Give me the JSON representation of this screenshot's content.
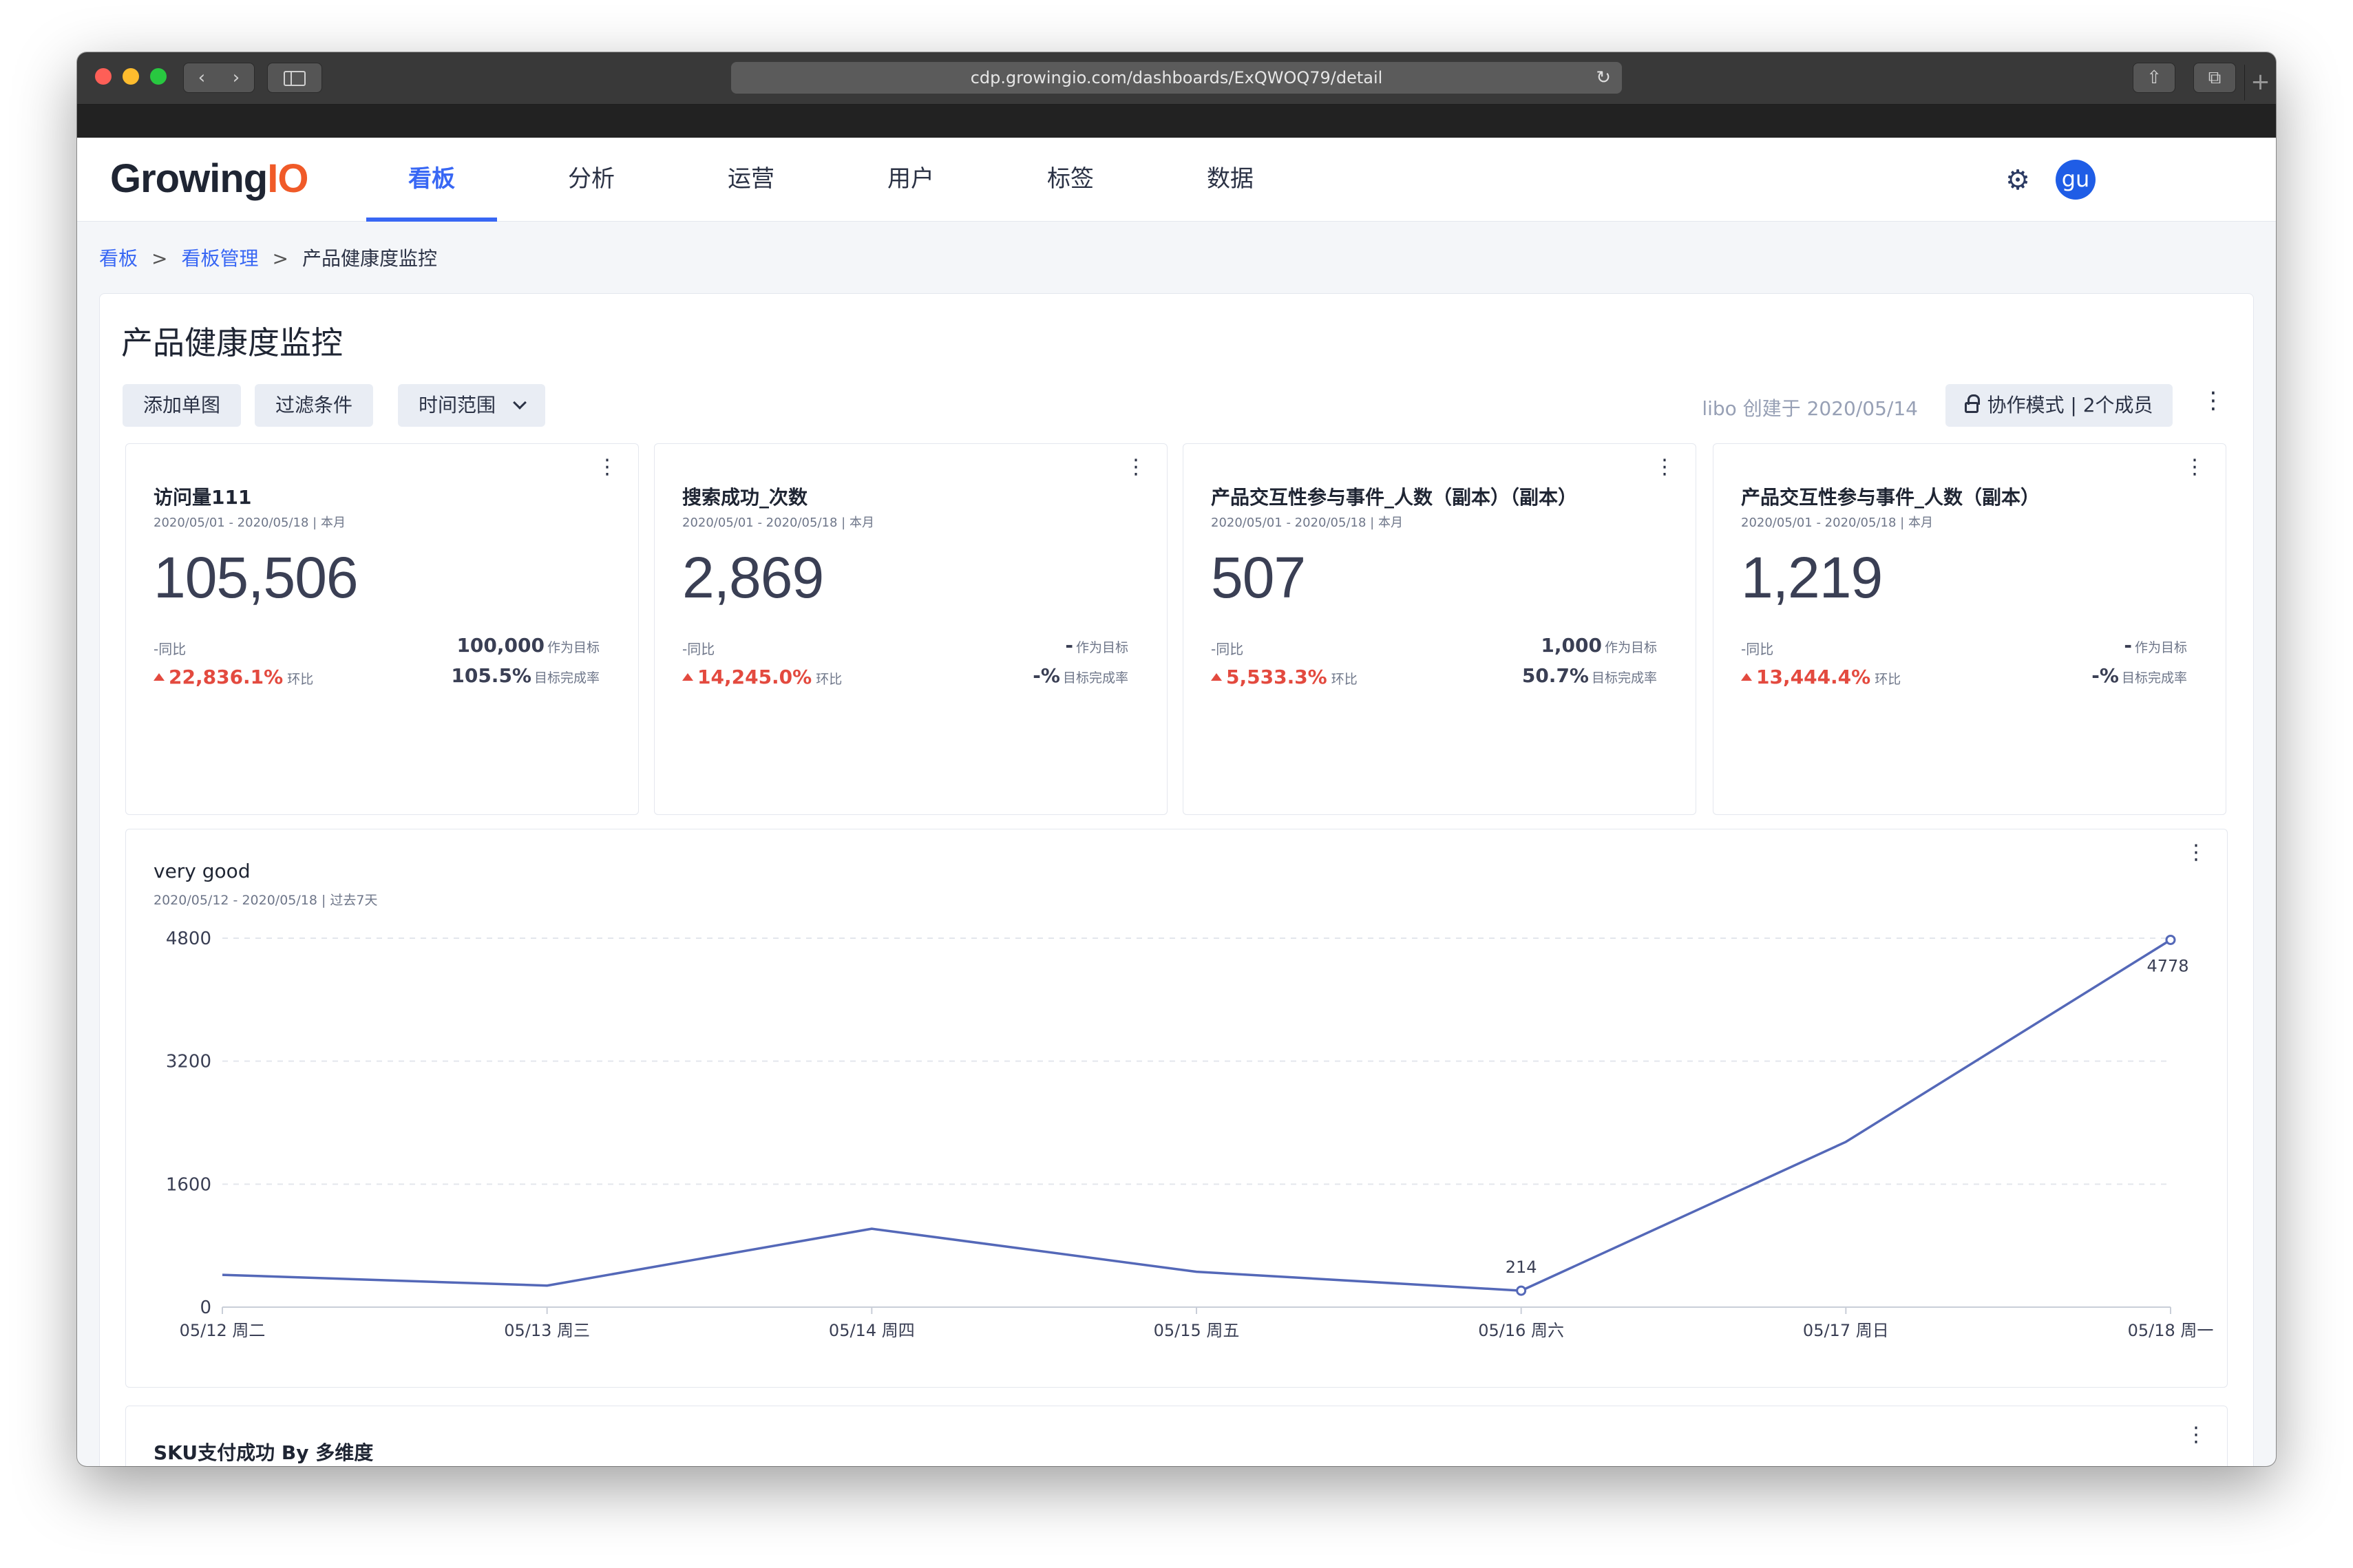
{
  "browser": {
    "url": "cdp.growingio.com/dashboards/ExQWOQ79/detail",
    "back_label": "‹",
    "forward_label": "›",
    "reload_glyph": "↻",
    "share_glyph": "⇧",
    "tabs_glyph": "⧉",
    "plus_glyph": "+"
  },
  "app": {
    "logo_main": "Growing",
    "logo_accent": "IO",
    "nav": [
      "看板",
      "分析",
      "运营",
      "用户",
      "标签",
      "数据"
    ],
    "active_nav": "看板",
    "avatar_text": "gu",
    "settings_icon": "gear-icon"
  },
  "breadcrumb": {
    "items": [
      "看板",
      "看板管理",
      "产品健康度监控"
    ],
    "separator": ">"
  },
  "page": {
    "title": "产品健康度监控",
    "toolbar": {
      "add_chart": "添加单图",
      "filter": "过滤条件",
      "time_range": "时间范围"
    },
    "creator_text": "libo 创建于 2020/05/14",
    "collab_text": "协作模式 | 2个成员",
    "more_glyph": "⋮"
  },
  "cards": [
    {
      "title": "访问量111",
      "subtitle": "2020/05/01 - 2020/05/18 | 本月",
      "value": "105,506",
      "yoy_value": "-",
      "yoy_label": "同比",
      "mom_value": "22,836.1%",
      "mom_label": "环比",
      "target_value": "100,000",
      "target_label": "作为目标",
      "completion_value": "105.5%",
      "completion_label": "目标完成率"
    },
    {
      "title": "搜索成功_次数",
      "subtitle": "2020/05/01 - 2020/05/18 | 本月",
      "value": "2,869",
      "yoy_value": "-",
      "yoy_label": "同比",
      "mom_value": "14,245.0%",
      "mom_label": "环比",
      "target_value": "-",
      "target_label": "作为目标",
      "completion_value": "-%",
      "completion_label": "目标完成率"
    },
    {
      "title": "产品交互性参与事件_人数（副本）（副本）",
      "subtitle": "2020/05/01 - 2020/05/18 | 本月",
      "value": "507",
      "yoy_value": "-",
      "yoy_label": "同比",
      "mom_value": "5,533.3%",
      "mom_label": "环比",
      "target_value": "1,000",
      "target_label": "作为目标",
      "completion_value": "50.7%",
      "completion_label": "目标完成率"
    },
    {
      "title": "产品交互性参与事件_人数（副本）",
      "subtitle": "2020/05/01 - 2020/05/18 | 本月",
      "value": "1,219",
      "yoy_value": "-",
      "yoy_label": "同比",
      "mom_value": "13,444.4%",
      "mom_label": "环比",
      "target_value": "-",
      "target_label": "作为目标",
      "completion_value": "-%",
      "completion_label": "目标完成率"
    }
  ],
  "line_card": {
    "title": "very good",
    "subtitle": "2020/05/12 - 2020/05/18 | 过去7天"
  },
  "bottom_card": {
    "title": "SKU支付成功 By 多维度"
  },
  "chart_data": {
    "type": "line",
    "x": [
      "05/12 周二",
      "05/13 周三",
      "05/14 周四",
      "05/15 周五",
      "05/16 周六",
      "05/17 周日",
      "05/18 周一"
    ],
    "series": [
      {
        "values": [
          420,
          280,
          1020,
          460,
          214,
          2150,
          4778
        ]
      }
    ],
    "data_labels": [
      {
        "index": 4,
        "text": "214"
      },
      {
        "index": 6,
        "text": "4778"
      }
    ],
    "yticks": [
      0,
      1600,
      3200,
      4800
    ],
    "ylim": [
      0,
      4800
    ],
    "grid": "horizontal dashed",
    "line_color": "#5468b8"
  }
}
